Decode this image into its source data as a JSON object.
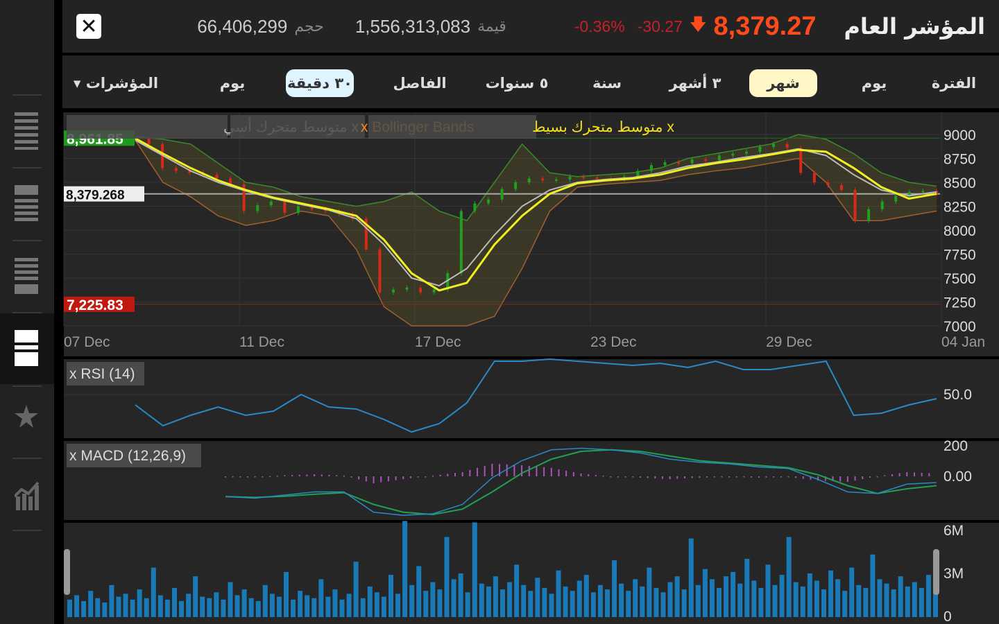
{
  "header": {
    "title": "المؤشر العام",
    "price": "8,379.27",
    "change": "-30.27",
    "change_pct": "-0.36%",
    "value_label": "قيمة",
    "value": "1,556,313,083",
    "volume_label": "حجم",
    "volume": "66,406,299",
    "close_icon": "close-icon",
    "direction_icon": "arrow-down-icon"
  },
  "toolbar": {
    "period_label": "الفترة",
    "periods": [
      "يوم",
      "شهر",
      "٣ أشهر",
      "سنة",
      "٥ سنوات"
    ],
    "selected_period": "شهر",
    "interval_label": "الفاصل",
    "intervals": [
      "٣٠ دقيقة",
      "يوم"
    ],
    "selected_interval": "٣٠ دقيقة",
    "indicators_label": "المؤشرات"
  },
  "sidebar": {
    "items": [
      "layout-1-icon",
      "layout-2-icon",
      "layout-3-icon",
      "layout-4-icon",
      "star-icon",
      "chart-icon"
    ],
    "active": 3
  },
  "colors": {
    "up": "#1fa01f",
    "down": "#d82a1a",
    "sma": "#f0f020",
    "ema": "#bbbbbb",
    "bollinger": "#3a8a2a",
    "rsi": "#2a8ac8",
    "macd": "#2a8ac8",
    "signal": "#20a050",
    "hist": "#b050c0",
    "volume": "#1a7ab8",
    "high_tag": "#1e9a1e",
    "low_tag": "#c01a10",
    "accent_price": "#ff4a1c"
  },
  "chart_data": [
    {
      "type": "candlestick",
      "legend": [
        "x متوسط متحرك أسي",
        "x Bollinger Bands",
        "x متوسط متحرك بسيط"
      ],
      "x_ticks": [
        "07 Dec",
        "11 Dec",
        "17 Dec",
        "23 Dec",
        "29 Dec",
        "04 Jan"
      ],
      "y_ticks": [
        9000,
        8750,
        8500,
        8250,
        8000,
        7750,
        7500,
        7250,
        7000
      ],
      "ylim": [
        7000,
        9000
      ],
      "high_label": "8,961.85",
      "high": 8961.85,
      "low_label": "7,225.83",
      "low": 7225.83,
      "last_label": "8,379.268",
      "last": 8379.268,
      "close": [
        8960,
        8900,
        8650,
        8620,
        8600,
        8580,
        8540,
        8480,
        8200,
        8260,
        8300,
        8180,
        8250,
        8220,
        8200,
        8170,
        8120,
        7800,
        7350,
        7380,
        7400,
        7350,
        7380,
        7550,
        8200,
        8280,
        8320,
        8430,
        8500,
        8540,
        8520,
        8530,
        8560,
        8550,
        8540,
        8530,
        8560,
        8620,
        8680,
        8710,
        8700,
        8740,
        8730,
        8780,
        8800,
        8820,
        8870,
        8900,
        8860,
        8600,
        8500,
        8470,
        8420,
        8100,
        8220,
        8300,
        8360,
        8400,
        8410,
        8380
      ],
      "sma": [
        8960,
        8800,
        8650,
        8520,
        8420,
        8340,
        8280,
        8220,
        8150,
        7900,
        7550,
        7370,
        7450,
        7850,
        8150,
        8380,
        8490,
        8520,
        8540,
        8580,
        8650,
        8700,
        8740,
        8790,
        8840,
        8820,
        8650,
        8450,
        8330,
        8380
      ],
      "ema": [
        8940,
        8780,
        8620,
        8500,
        8410,
        8330,
        8270,
        8210,
        8120,
        7850,
        7500,
        7420,
        7600,
        7950,
        8250,
        8420,
        8500,
        8530,
        8550,
        8600,
        8670,
        8710,
        8760,
        8800,
        8850,
        8780,
        8580,
        8420,
        8360,
        8400
      ],
      "bb_upper": [
        8980,
        8950,
        8900,
        8700,
        8500,
        8450,
        8350,
        8300,
        8250,
        8300,
        8400,
        8200,
        8100,
        8500,
        8900,
        8600,
        8560,
        8580,
        8600,
        8650,
        8750,
        8800,
        8850,
        8900,
        9000,
        8950,
        8800,
        8600,
        8500,
        8460
      ],
      "bb_lower": [
        8940,
        8500,
        8350,
        8150,
        8050,
        8100,
        8200,
        8150,
        7800,
        7200,
        7000,
        6950,
        7000,
        7100,
        7600,
        8200,
        8450,
        8480,
        8500,
        8520,
        8580,
        8620,
        8650,
        8700,
        8750,
        8500,
        8100,
        8100,
        8150,
        8200
      ]
    },
    {
      "type": "line",
      "legend": "x RSI (14)",
      "y_ticks": [
        "50.0"
      ],
      "rsi": [
        45,
        35,
        40,
        44,
        40,
        42,
        50,
        44,
        43,
        38,
        32,
        36,
        46,
        66,
        66,
        67,
        66,
        65,
        64,
        65,
        63,
        66,
        62,
        62,
        64,
        66,
        40,
        41,
        45,
        48
      ]
    },
    {
      "type": "line",
      "legend": "x MACD (12,26,9)",
      "y_ticks": [
        "200",
        "0.00"
      ],
      "macd": [
        -130,
        -140,
        -120,
        -100,
        -100,
        -230,
        -250,
        -240,
        -180,
        -10,
        100,
        170,
        180,
        170,
        150,
        110,
        90,
        80,
        60,
        50,
        -20,
        -100,
        -110,
        -50,
        -40
      ],
      "signal": [
        -130,
        -135,
        -128,
        -115,
        -105,
        -180,
        -230,
        -245,
        -210,
        -100,
        20,
        110,
        160,
        170,
        160,
        130,
        100,
        85,
        70,
        55,
        10,
        -60,
        -110,
        -80,
        -60
      ]
    },
    {
      "type": "bar",
      "y_ticks": [
        "6M",
        "3M",
        "0"
      ],
      "ylim": [
        0,
        6
      ],
      "volume": [
        1.2,
        1.5,
        1.1,
        1.8,
        1.3,
        1.0,
        2.2,
        1.4,
        1.6,
        1.2,
        1.9,
        1.3,
        3.4,
        1.5,
        1.2,
        2.0,
        1.1,
        1.6,
        2.8,
        1.4,
        1.3,
        1.7,
        1.2,
        2.4,
        1.5,
        1.9,
        1.3,
        1.1,
        2.2,
        1.6,
        1.4,
        3.1,
        1.2,
        1.8,
        1.5,
        1.3,
        2.6,
        1.4,
        1.9,
        1.2,
        1.6,
        3.8,
        1.3,
        2.1,
        1.7,
        1.4,
        2.9,
        1.6,
        6.6,
        2.2,
        3.5,
        1.8,
        2.4,
        1.9,
        5.5,
        2.6,
        3.0,
        1.7,
        6.5,
        2.3,
        2.1,
        2.8,
        1.9,
        2.4,
        3.6,
        2.2,
        1.8,
        2.7,
        2.0,
        1.6,
        3.2,
        2.1,
        1.8,
        2.5,
        2.9,
        1.7,
        2.2,
        1.9,
        3.9,
        2.3,
        1.8,
        2.6,
        2.1,
        3.4,
        2.0,
        1.7,
        2.4,
        2.8,
        1.9,
        5.4,
        2.2,
        3.3,
        2.6,
        2.0,
        2.8,
        3.1,
        2.3,
        4.0,
        2.5,
        2.0,
        3.6,
        2.2,
        2.9,
        5.5,
        2.4,
        2.1,
        3.0,
        2.5,
        1.9,
        3.2,
        2.6,
        1.8,
        3.4,
        2.2,
        2.0,
        4.3,
        2.6,
        2.3,
        1.9,
        2.8,
        2.1,
        2.4,
        2.0,
        2.9,
        2.3
      ]
    }
  ]
}
